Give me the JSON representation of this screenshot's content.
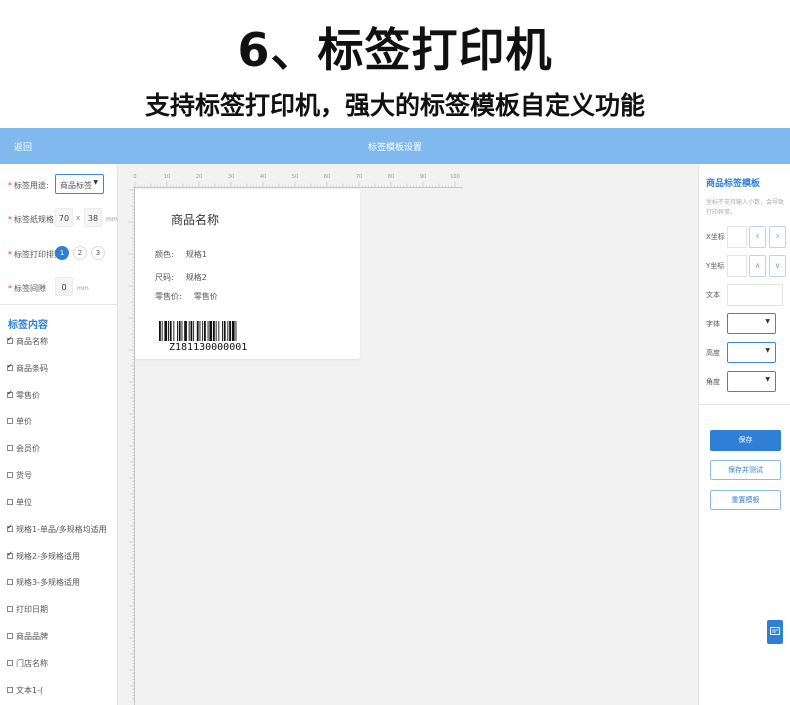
{
  "promo": {
    "title": "6、标签打印机",
    "subtitle": "支持标签打印机，强大的标签模板自定义功能"
  },
  "app": {
    "back_label": "返回",
    "window_title": "标签模板设置"
  },
  "left_panel": {
    "purpose": {
      "label": "标签用途:",
      "value": "商品标签"
    },
    "size": {
      "label": "标签纸规格",
      "width": "70",
      "x": "x",
      "height": "38",
      "unit": "mm"
    },
    "rows": {
      "label": "标签打印排数",
      "options": [
        "1",
        "2",
        "3"
      ],
      "selected": "1"
    },
    "gap": {
      "label": "标签间隙",
      "value": "0",
      "unit": "mm"
    },
    "content_title": "标签内容",
    "items": [
      {
        "label": "商品名称",
        "checked": true
      },
      {
        "label": "商品条码",
        "checked": true
      },
      {
        "label": "零售价",
        "checked": true
      },
      {
        "label": "单价",
        "checked": false
      },
      {
        "label": "会员价",
        "checked": false
      },
      {
        "label": "货号",
        "checked": false
      },
      {
        "label": "单位",
        "checked": false
      },
      {
        "label": "规格1-单品/多规格均适用",
        "checked": true
      },
      {
        "label": "规格2-多规格适用",
        "checked": true
      },
      {
        "label": "规格3-多规格适用",
        "checked": false
      },
      {
        "label": "打印日期",
        "checked": false
      },
      {
        "label": "商品品牌",
        "checked": false
      },
      {
        "label": "门店名称",
        "checked": false
      },
      {
        "label": "文本1-(",
        "checked": false
      }
    ]
  },
  "canvas": {
    "ruler_labels": [
      "0",
      "10",
      "20",
      "30",
      "40",
      "50",
      "60",
      "70",
      "80",
      "90",
      "100"
    ],
    "label": {
      "name": "商品名称",
      "color_label": "颜色:",
      "color_value": "规格1",
      "size_label": "尺码:",
      "size_value": "规格2",
      "price_label": "零售价:",
      "price_value": "零售价",
      "barcode_number": "Z181130000001"
    }
  },
  "right_panel": {
    "title": "商品标签模板",
    "hint": "坐标不支持输入小数，会导致打印异常。",
    "x_label": "X坐标",
    "y_label": "Y坐标",
    "text_label": "文本",
    "font_label": "字体",
    "height_label": "高度",
    "angle_label": "角度",
    "save_label": "保存",
    "save_test_label": "保存并测试",
    "reset_label": "重置模板"
  },
  "colors": {
    "topbar": "#7fb9ee",
    "accent": "#2f7fd6"
  }
}
